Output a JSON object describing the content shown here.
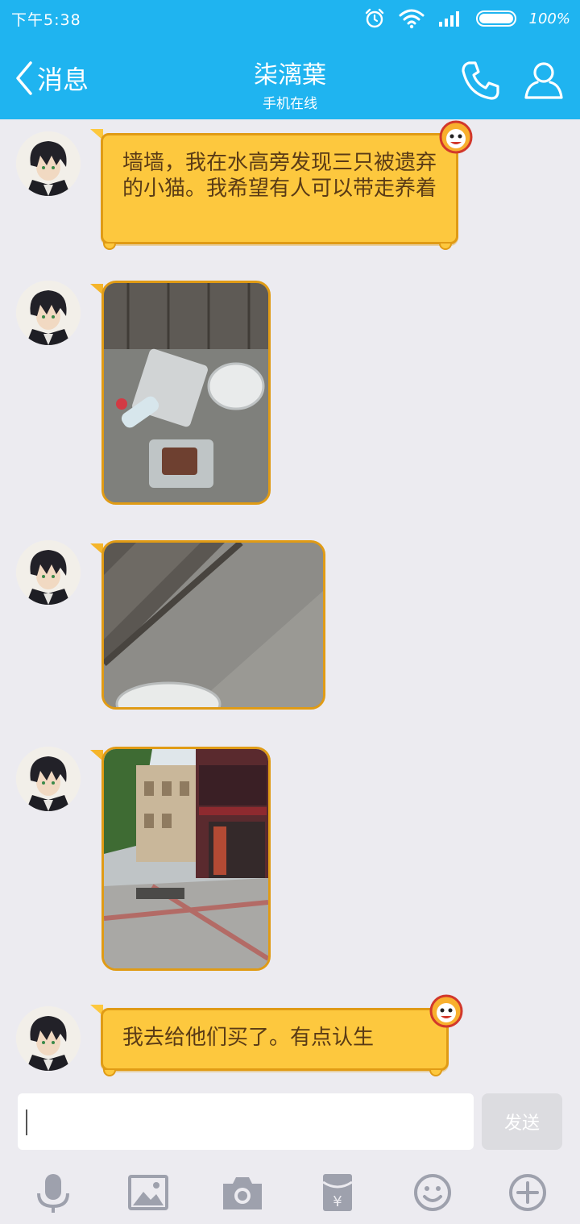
{
  "status_bar": {
    "time": "下午5:38",
    "battery": "100%"
  },
  "header": {
    "back_label": "消息",
    "title": "柒漓葉",
    "subtitle": "手机在线"
  },
  "messages": [
    {
      "type": "text",
      "text": "墙墙，我在水高旁发现三只被遗弃的小猫。我希望有人可以带走养着"
    },
    {
      "type": "image",
      "description": "photo-1"
    },
    {
      "type": "image",
      "description": "photo-2"
    },
    {
      "type": "image",
      "description": "photo-3"
    },
    {
      "type": "text",
      "text": "我去给他们买了。有点认生"
    }
  ],
  "input": {
    "value": "",
    "send_label": "发送"
  },
  "toolbar": [
    "mic-icon",
    "image-icon",
    "camera-icon",
    "red-packet-icon",
    "emoji-icon",
    "plus-icon"
  ],
  "colors": {
    "header": "#1fb4f0",
    "bubble": "#fdc83e",
    "bubble_border": "#e09b15",
    "background": "#ecebf0"
  }
}
